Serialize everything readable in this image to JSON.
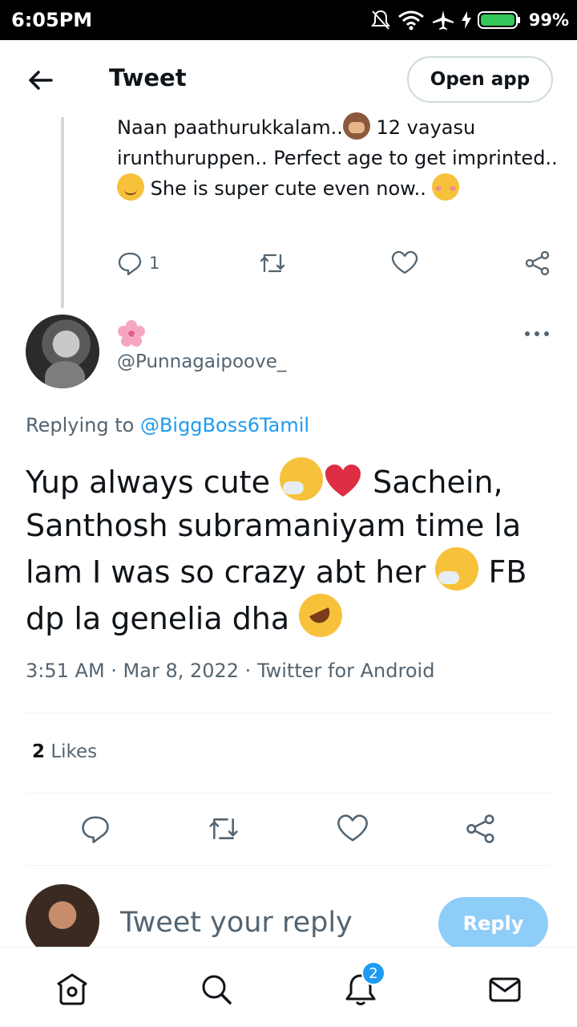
{
  "status_bar": {
    "time": "6:05PM",
    "battery": "99%"
  },
  "header": {
    "title": "Tweet",
    "open_app": "Open app"
  },
  "parent_tweet": {
    "text_1": "Naan paathurukkalam..",
    "text_2": " 12 vayasu irunthuruppen.. Perfect age to get imprinted..",
    "text_3": " She is super cute even now..",
    "reply_count": "1"
  },
  "main_tweet": {
    "handle": "@Punnagaipoove_",
    "replying_prefix": "Replying to ",
    "replying_to": "@BiggBoss6Tamil",
    "text_1": "Yup always cute ",
    "text_2": " Sachein, Santhosh subramaniyam time la lam I was so crazy abt her ",
    "text_3": " FB dp la genelia dha ",
    "meta": "3:51 AM · Mar 8, 2022 · Twitter for Android",
    "likes_count": "2",
    "likes_label": " Likes"
  },
  "composer": {
    "placeholder": "Tweet your reply",
    "reply_label": "Reply"
  },
  "bottom_nav": {
    "notifications_badge": "2"
  },
  "icons": {
    "flower": "cherry-blossom-icon",
    "emojis": [
      "see-no-evil-monkey",
      "relieved-face",
      "smiling-face",
      "sneezing-face",
      "red-heart",
      "sneezing-face",
      "rolling-on-floor-laughing"
    ]
  },
  "colors": {
    "accent": "#1d9bf0",
    "muted": "#536471",
    "reply_button": "#8ecdf7",
    "text": "#0f1419"
  }
}
